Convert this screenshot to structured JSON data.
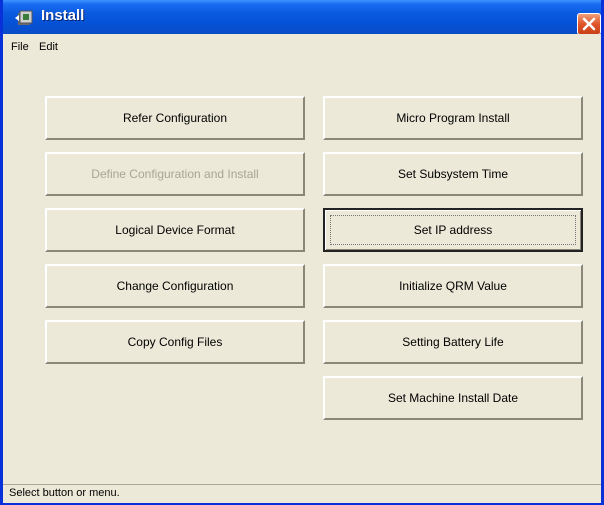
{
  "window": {
    "title": "Install"
  },
  "menu": [
    {
      "label": "File"
    },
    {
      "label": "Edit"
    }
  ],
  "buttons": [
    {
      "label": "Refer Configuration",
      "enabled": true
    },
    {
      "label": "Micro Program Install",
      "enabled": true
    },
    {
      "label": "Define Configuration and Install",
      "enabled": false
    },
    {
      "label": "Set Subsystem Time",
      "enabled": true
    },
    {
      "label": "Logical Device Format",
      "enabled": true
    },
    {
      "label": "Set IP address",
      "enabled": true,
      "focused": true
    },
    {
      "label": "Change Configuration",
      "enabled": true
    },
    {
      "label": "Initialize QRM Value",
      "enabled": true
    },
    {
      "label": "Copy Config Files",
      "enabled": true
    },
    {
      "label": "Setting Battery Life",
      "enabled": true
    },
    {
      "label": "Set Machine Install Date",
      "enabled": true
    }
  ],
  "status": {
    "text": "Select button or menu."
  }
}
